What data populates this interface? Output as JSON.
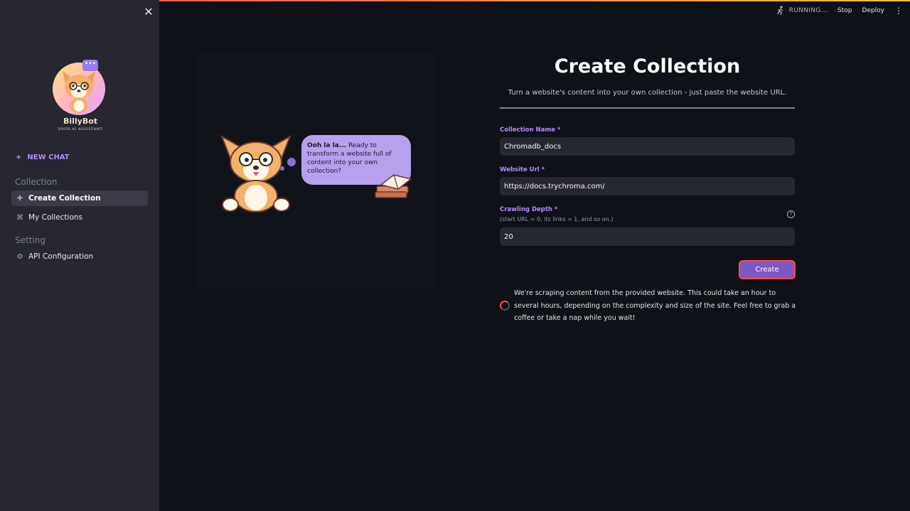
{
  "topbar": {
    "status": "RUNNING...",
    "stop_label": "Stop",
    "deploy_label": "Deploy",
    "icon_running": "running-man-icon",
    "icon_menu": "kebab-icon"
  },
  "sidebar": {
    "close_icon": "close-icon",
    "brand_name": "BillyBot",
    "brand_tagline": "YOUR AI ASSISTANT",
    "new_chat": "NEW CHAT",
    "sections": [
      {
        "label": "Collection",
        "items": [
          {
            "label": "Create Collection",
            "icon": "plus-icon",
            "active": true
          },
          {
            "label": "My Collections",
            "icon": "command-icon",
            "active": false
          }
        ]
      },
      {
        "label": "Setting",
        "items": [
          {
            "label": "API Configuration",
            "icon": "gear-icon",
            "active": false
          }
        ]
      }
    ]
  },
  "illustration": {
    "speech_bold": "Ooh la la...",
    "speech_text": " Ready to transform a website full of content into your own collection?"
  },
  "main": {
    "title": "Create Collection",
    "subtitle": "Turn a website's content into your own collection - just paste the website URL.",
    "fields": {
      "collection_name": {
        "label": "Collection Name *",
        "value": "Chromadb_docs"
      },
      "website_url": {
        "label": "Website Url *",
        "value": "https://docs.trychroma.com/"
      },
      "crawling_depth": {
        "label": "Crawling Depth *",
        "help": "(start URL = 0, its links = 1, and so on.)",
        "value": "20"
      }
    },
    "create_label": "Create",
    "status_message": "We're scraping content from the provided website. This could take an hour to several hours, depending on the complexity and size of the site. Feel free to grab a coffee or take a nap while you wait!"
  },
  "colors": {
    "background": "#0e1117",
    "sidebar": "#262730",
    "accent": "#b48cff",
    "button": "#7e57c2",
    "highlight": "#ff4b4b"
  }
}
